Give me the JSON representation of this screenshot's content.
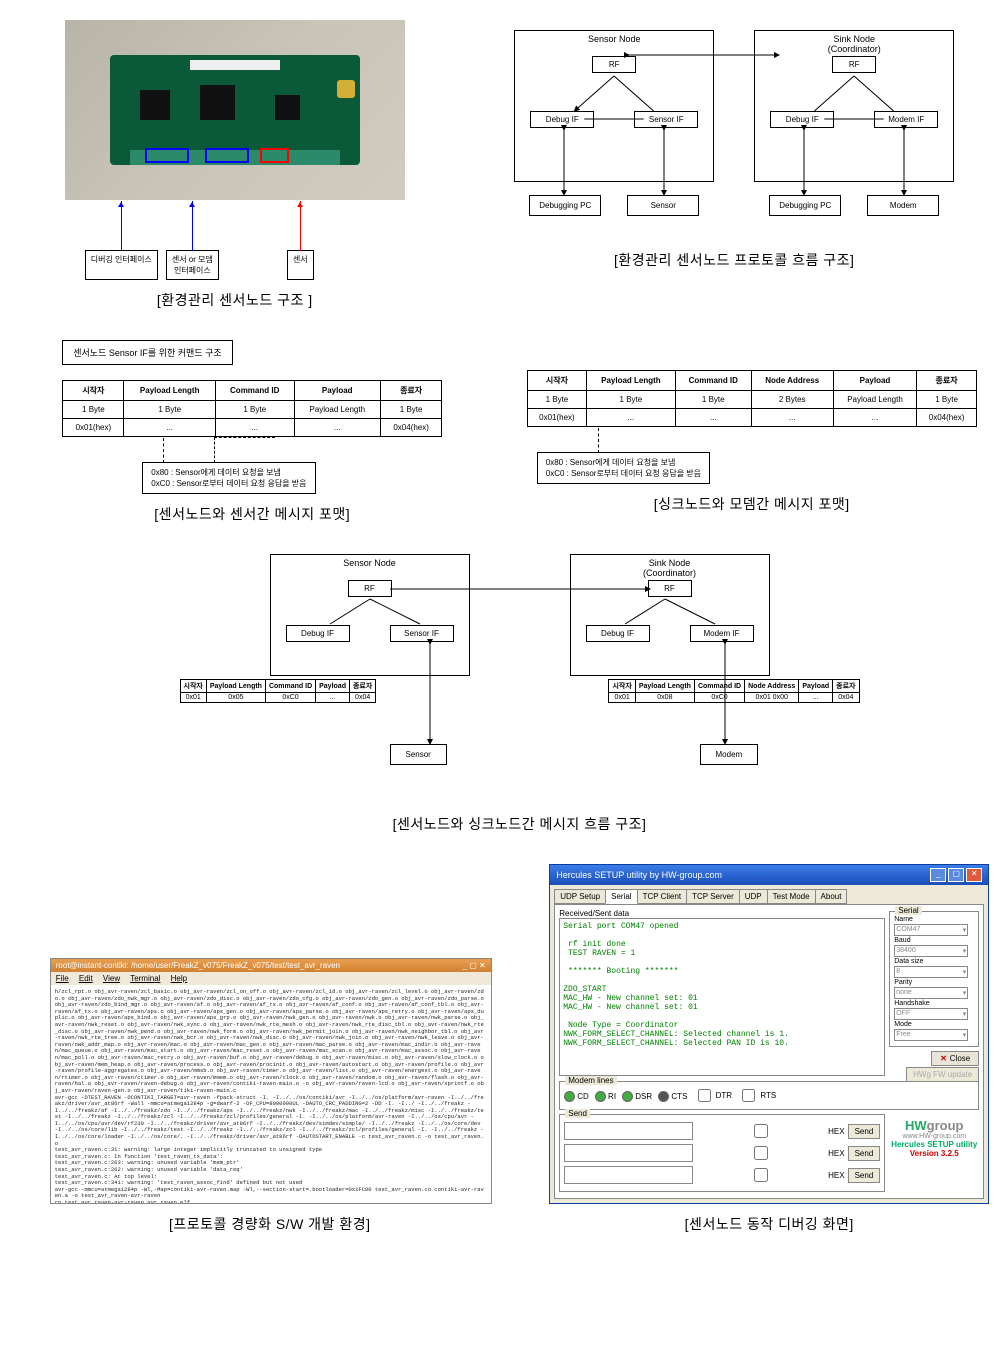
{
  "captions": {
    "c1": "[환경관리 센서노드 구조 ]",
    "c2": "[환경관리 센서노드 프로토콜 흐름 구조]",
    "c3": "[센서노드와 센서간 메시지 포맷]",
    "c4": "[싱크노드와 모뎀간 메시지 포맷]",
    "c5": "[센서노드와 싱크노드간 메시지 흐름 구조]",
    "c6": "[프로토콜 경량화 S/W 개발 환경]",
    "c7": "[센서노드 동작 디버깅 화면]"
  },
  "pcb": {
    "label1": "디버깅 인터페이스",
    "label2a": "센서 or 모뎀",
    "label2b": "인터페이스",
    "label3": "센서"
  },
  "protoDiagram": {
    "sensorNode": "Sensor Node",
    "sinkNode": "Sink Node",
    "coordinator": "(Coordinator)",
    "rf": "RF",
    "debugIf": "Debug IF",
    "sensorIf": "Sensor IF",
    "modemIf": "Modem IF",
    "debugPc": "Debugging PC",
    "sensor": "Sensor",
    "modem": "Modem"
  },
  "msgTableSensor": {
    "title": "센서노드 Sensor IF를 위한 커맨드 구조",
    "headers": [
      "시작자",
      "Payload Length",
      "Command ID",
      "Payload",
      "종료자"
    ],
    "row1": [
      "1 Byte",
      "1 Byte",
      "1 Byte",
      "Payload Length",
      "1 Byte"
    ],
    "row2": [
      "0x01(hex)",
      "...",
      "...",
      "...",
      "0x04(hex)"
    ],
    "note1": "0x80 : Sensor에게 데이터 요청을 보냄",
    "note2": "0xC0 : Sensor로부터 데이터 요청 응답을 받음"
  },
  "msgTableModem": {
    "headers": [
      "시작자",
      "Payload Length",
      "Command ID",
      "Node Address",
      "Payload",
      "종료자"
    ],
    "row1": [
      "1 Byte",
      "1 Byte",
      "1 Byte",
      "2 Bytes",
      "Payload Length",
      "1 Byte"
    ],
    "row2": [
      "0x01(hex)",
      "...",
      "...",
      "...",
      "...",
      "0x04(hex)"
    ],
    "note1": "0x80 : Sensor에게 데이터 요청을 보냄",
    "note2": "0xC0 : Sensor로부터 데이터 요청 응답을 받음"
  },
  "flowDiagram": {
    "sensorNode": "Sensor Node",
    "sinkNode": "Sink Node",
    "coordinator": "(Coordinator)",
    "rf": "RF",
    "debugIf": "Debug IF",
    "sensorIf": "Sensor IF",
    "modemIf": "Modem IF",
    "sensor": "Sensor",
    "modem": "Modem",
    "tiny1Headers": [
      "시작자",
      "Payload Length",
      "Command ID",
      "Payload",
      "종료자"
    ],
    "tiny1Row": [
      "0x01",
      "0x05",
      "0xC0",
      "...",
      "0x04"
    ],
    "tiny2Headers": [
      "시작자",
      "Payload Length",
      "Command ID",
      "Node Address",
      "Payload",
      "종료자"
    ],
    "tiny2Row": [
      "0x01",
      "0x08",
      "0xC0",
      "0x01 0x00",
      "...",
      "0x04"
    ]
  },
  "terminal": {
    "title": "root@instant-contiki: /home/user/FreakZ_v075/FreakZ_v075/test/test_avr_raven",
    "menu": [
      "File",
      "Edit",
      "View",
      "Terminal",
      "Help"
    ],
    "body": "h/zcl_rpt.o obj_avr-raven/zcl_basic.o obj_avr-raven/zcl_on_off.o obj_avr-raven/zcl_id.o obj_avr-raven/zcl_level.o obj_avr-raven/zdo.o obj_avr-raven/zdo_nwk_mgr.o obj_avr-raven/zdo_disc.o obj_avr-raven/zdo_cfg.o obj_avr-raven/zdo_gen.o obj_avr-raven/zdo_parse.o obj_avr-raven/zdo_bind_mgr.o obj_avr-raven/af.o obj_avr-raven/af_rx.o obj_avr-raven/af_conf.o obj_avr-raven/af_conf_tbl.o obj_avr-raven/af_tx.o obj_avr-raven/aps.o obj_avr-raven/aps_gen.o obj_avr-raven/aps_parse.o obj_avr-raven/aps_retry.o obj_avr-raven/aps_duplic.o obj_avr-raven/aps_bind.o obj_avr-raven/aps_grp.o obj_avr-raven/nwk_gen.o obj_avr-raven/nwk.o obj_avr-raven/nwk_parse.o obj_avr-raven/nwk_reset.o obj_avr-raven/nwk_sync.o obj_avr-raven/nwk_rte_mesh.o obj_avr-raven/nwk_rte_disc_tbl.o obj_avr-raven/nwk_rte_disc.o obj_avr-raven/nwk_pend.o obj_avr-raven/nwk_form.o obj_avr-raven/nwk_permit_join.o obj_avr-raven/nwk_neighbor_tbl.o obj_avr-raven/nwk_rte_tree.o obj_avr-raven/nwk_bcr.o obj_avr-raven/nwk_disc.o obj_avr-raven/nwk_join.o obj_avr-raven/nwk_leave.o obj_avr-raven/nwk_addr_map.o obj_avr-raven/mac.o obj_avr-raven/mac_gen.o obj_avr-raven/mac_parse.o obj_avr-raven/mac_indir.o obj_avr-raven/mac_queue.o obj_avr-raven/mac_start.o obj_avr-raven/mac_reset.o obj_avr-raven/mac_scan.o obj_avr-raven/mac_assoc.o obj_avr-raven/mac_poll.o obj_avr-raven/mac_retry.o obj_avr-raven/buf.o obj_avr-raven/debug.o obj_avr-raven/misc.o obj_avr-raven/slow_clock.o obj_avr-raven/mem_heap.o obj_avr-raven/process.o obj_avr-raven/procinit.o obj_avr-raven/autostart.o obj_avr-raven/profile.o obj_avr-raven/profile-aggregates.o obj_avr-raven/mmsb.o obj_avr-raven/timer.o obj_avr-raven/list.o obj_avr-raven/energest.o obj_avr-raven/rtimer.o obj_avr-raven/ctimer.o obj_avr-raven/mmem.o obj_avr-raven/clock.o obj_avr-raven/random.o obj_avr-raven/flash.o obj_avr-raven/hal.o obj_avr-raven/raven-debug.o obj_avr-raven/contiki-raven-main.o -o obj_avr-raven/raven-lcd.o obj_avr-raven/xprintf.o obj_avr-raven/raven-gen.o obj_avr-raven/tiki-raven-main.c\navr-gcc -DTEST_RAVEN -DCONTIKI_TARGET=avr-raven -fpack-struct -I. -I../../os/contiki/avr -I../../os/platform/avr-raven -I../../freakz/driver/avr_at86rf -Wall -mmcu=atmega1284p -g=dwarf-2 -DF_CPU=8000000UL -DAUTO_CRC_PADDING=2 -DD -I. -I../ -I../../freakz -I../../freakz/af -I../../freakz/zdo -I../../freakz/aps -I../../freakz/nwk -I../../freakz/mac -I../../freakz/misc -I../../freakz/test -I../../freakz -I../../freakz/zcl -I../../freakz/zcl/profiles/general -I. -I../../os/platform/avr-raven -I../../os/cpu/avr -I../../os/cpu/avr/dev/rf230 -I../../freakz/driver/avr_at86rf -I../../freakz/dev/simdev/simple/ -I../../freakz -I../../os/core/dev -I../../os/core/lib -I../../freakz/test -I../../freakz -I../../freakz/zcl -I../../freakz/zcl/profiles/general -I. -I../../freakz -I../../os/core/loader -I../../os/core/. -I../../freakz/driver/avr_at86rf -DAUTOSTART_ENABLE -c test_avr_raven.c -o test_avr_raven.o\ntest_avr_raven.c:31: warning: large integer implicitly truncated to unsigned type\ntest_avr_raven.c: In function 'test_raven_tx_data':\ntest_avr_raven.c:263: warning: unused variable 'mem_ptr'\ntest_avr_raven.c:262: warning: unused variable 'data_req'\ntest_avr_raven.c: At top level:\ntest_avr_raven.c:341: warning: 'test_raven_assoc_find' defined but not used\navr-gcc -mmcu=atmega1284p -Wl,-Map=contiki-avr-raven.map -Wl,--section-start=.bootloader=0x1FC00 test_avr_raven.co contiki-avr-raven.a -o test_avr_raven-avr-raven\ncp test_avr_raven-avr-raven avr_raven.elf\nrm test_avr_raven.co\nroot@instant-contiki:/home/user/FreakZ_v075/FreakZ_v075/test/test_avr_raven#"
  },
  "hercules": {
    "title": "Hercules SETUP utility by HW-group.com",
    "tabs": [
      "UDP Setup",
      "Serial",
      "TCP Client",
      "TCP Server",
      "UDP",
      "Test Mode",
      "About"
    ],
    "receivedLabel": "Received/Sent data",
    "serialText": "Serial port COM47 opened\n\n rf init done\n TEST RAVEN = 1\n\n ******* Booting *******\n\nZDO_START\nMAC_HW - New channel set: 01\nMAC_HW - New channel set: 01\n\n Node Type = Coordinator\nNWK_FORM_SELECT_CHANNEL: Selected channel is 1.\nNWK_FORM_SELECT_CHANNEL: Selected PAN ID is 10.",
    "side": {
      "serialLabel": "Serial",
      "name": "Name",
      "nameVal": "COM47",
      "baud": "Baud",
      "baudVal": "38400",
      "dataSize": "Data size",
      "dataSizeVal": "8",
      "parity": "Parity",
      "parityVal": "none",
      "handshake": "Handshake",
      "handshakeVal": "OFF",
      "mode": "Mode",
      "modeVal": "Free",
      "closeBtn": "Close",
      "fwBtn": "HWg FW update"
    },
    "modemLines": "Modem lines",
    "modem": [
      "CD",
      "RI",
      "DSR",
      "CTS",
      "DTR",
      "RTS"
    ],
    "sendLabel": "Send",
    "hex": "HEX",
    "sendBtn": "Send",
    "logo": "HWgroup",
    "logoSub": "www.HW-group.com",
    "logoTitle": "Hercules SETUP utility",
    "version": "Version  3.2.5"
  }
}
